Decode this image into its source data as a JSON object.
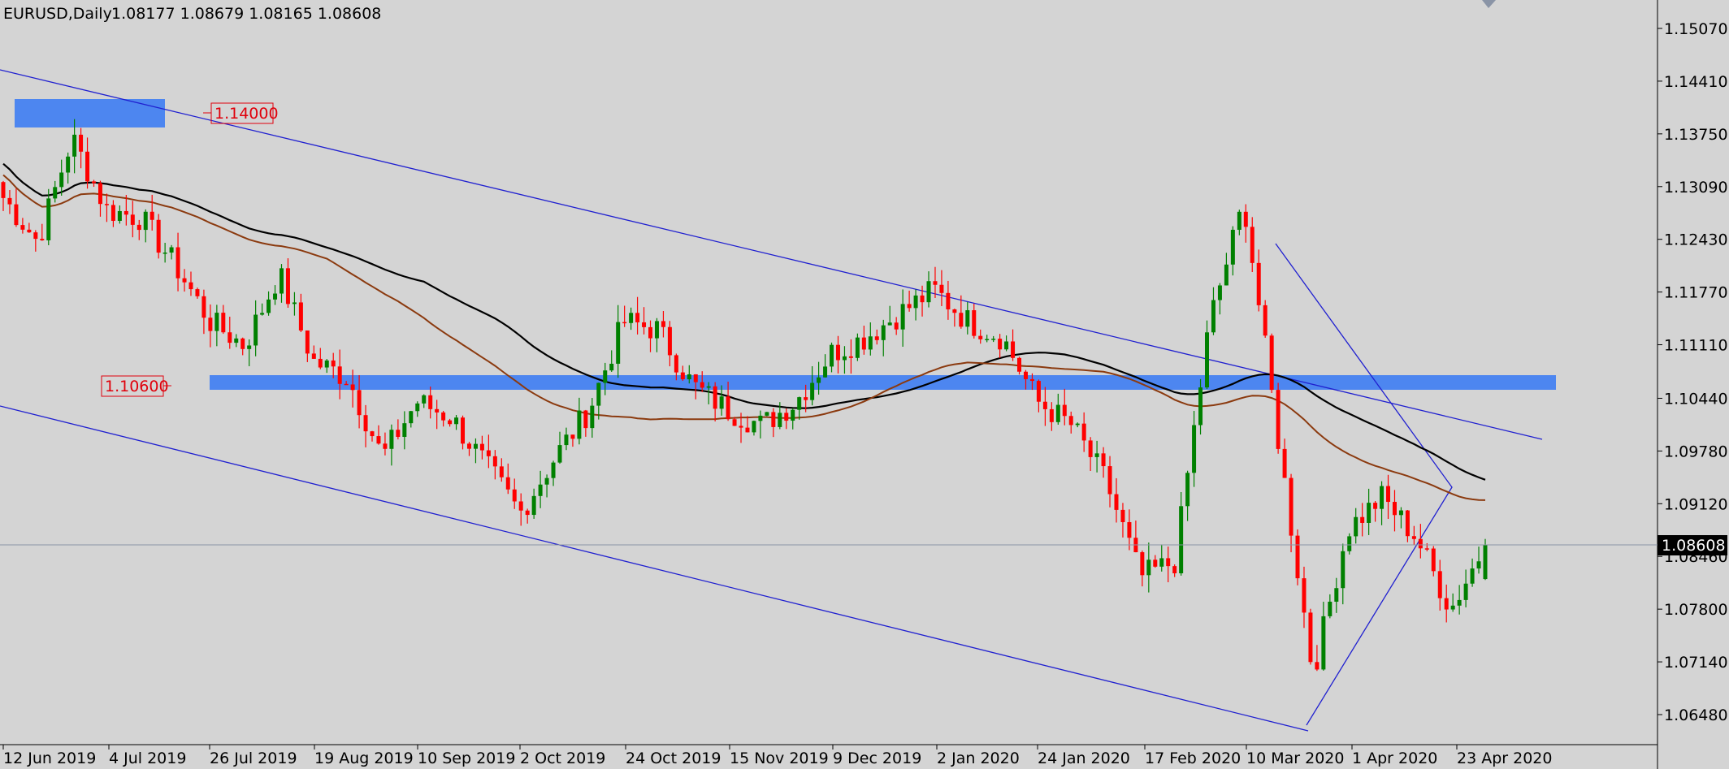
{
  "header": {
    "symbol": "EURUSD,Daily",
    "ohlc": "1.08177 1.08679 1.08165 1.08608"
  },
  "current_price": "1.08608",
  "level_labels": [
    "1.14000",
    "1.10600"
  ],
  "colors": {
    "background": "#d4d4d4",
    "bull": "#008000",
    "bear": "#ff0000",
    "ma_slow": "#000000",
    "ma_fast": "#8b3a0f",
    "trendline": "#2020d0",
    "zone": "#4d86f0",
    "level_text": "#e0000b",
    "price_box": "#000000"
  },
  "chart_data": {
    "type": "candlestick",
    "symbol": "EURUSD",
    "timeframe": "Daily",
    "y_ticks": [
      "1.15070",
      "1.14410",
      "1.13750",
      "1.13090",
      "1.12430",
      "1.11770",
      "1.11110",
      "1.10440",
      "1.09780",
      "1.09120",
      "1.08460",
      "1.07800",
      "1.07140",
      "1.06480"
    ],
    "x_ticks": [
      "12 Jun 2019",
      "4 Jul 2019",
      "26 Jul 2019",
      "19 Aug 2019",
      "10 Sep 2019",
      "2 Oct 2019",
      "24 Oct 2019",
      "15 Nov 2019",
      "9 Dec 2019",
      "2 Jan 2020",
      "24 Jan 2020",
      "17 Feb 2020",
      "10 Mar 2020",
      "1 Apr 2020",
      "23 Apr 2020"
    ],
    "last_ohlc": {
      "open": 1.08177,
      "high": 1.08679,
      "low": 1.08165,
      "close": 1.08608
    },
    "key_levels": [
      1.14,
      1.106
    ],
    "close_path": [
      [
        "12 Jun 2019",
        1.1295
      ],
      [
        "19 Jun 2019",
        1.124
      ],
      [
        "26 Jun 2019",
        1.137
      ],
      [
        "4 Jul 2019",
        1.128
      ],
      [
        "12 Jul 2019",
        1.127
      ],
      [
        "19 Jul 2019",
        1.121
      ],
      [
        "26 Jul 2019",
        1.114
      ],
      [
        "2 Aug 2019",
        1.111
      ],
      [
        "9 Aug 2019",
        1.12
      ],
      [
        "19 Aug 2019",
        1.109
      ],
      [
        "26 Aug 2019",
        1.107
      ],
      [
        "3 Sep 2019",
        1.097
      ],
      [
        "10 Sep 2019",
        1.104
      ],
      [
        "17 Sep 2019",
        1.102
      ],
      [
        "24 Sep 2019",
        1.096
      ],
      [
        "2 Oct 2019",
        1.09
      ],
      [
        "9 Oct 2019",
        1.097
      ],
      [
        "16 Oct 2019",
        1.103
      ],
      [
        "24 Oct 2019",
        1.114
      ],
      [
        "31 Oct 2019",
        1.113
      ],
      [
        "7 Nov 2019",
        1.106
      ],
      [
        "15 Nov 2019",
        1.103
      ],
      [
        "22 Nov 2019",
        1.101
      ],
      [
        "29 Nov 2019",
        1.104
      ],
      [
        "9 Dec 2019",
        1.11
      ],
      [
        "16 Dec 2019",
        1.112
      ],
      [
        "23 Dec 2019",
        1.115
      ],
      [
        "2 Jan 2020",
        1.118
      ],
      [
        "9 Jan 2020",
        1.114
      ],
      [
        "16 Jan 2020",
        1.112
      ],
      [
        "24 Jan 2020",
        1.104
      ],
      [
        "31 Jan 2020",
        1.101
      ],
      [
        "7 Feb 2020",
        1.094
      ],
      [
        "17 Feb 2020",
        1.082
      ],
      [
        "24 Feb 2020",
        1.084
      ],
      [
        "3 Mar 2020",
        1.114
      ],
      [
        "10 Mar 2020",
        1.129
      ],
      [
        "17 Mar 2020",
        1.099
      ],
      [
        "20 Mar 2020",
        1.07
      ],
      [
        "1 Apr 2020",
        1.088
      ],
      [
        "9 Apr 2020",
        1.092
      ],
      [
        "16 Apr 2020",
        1.087
      ],
      [
        "23 Apr 2020",
        1.078
      ],
      [
        "28 Apr 2020",
        1.0861
      ]
    ]
  }
}
